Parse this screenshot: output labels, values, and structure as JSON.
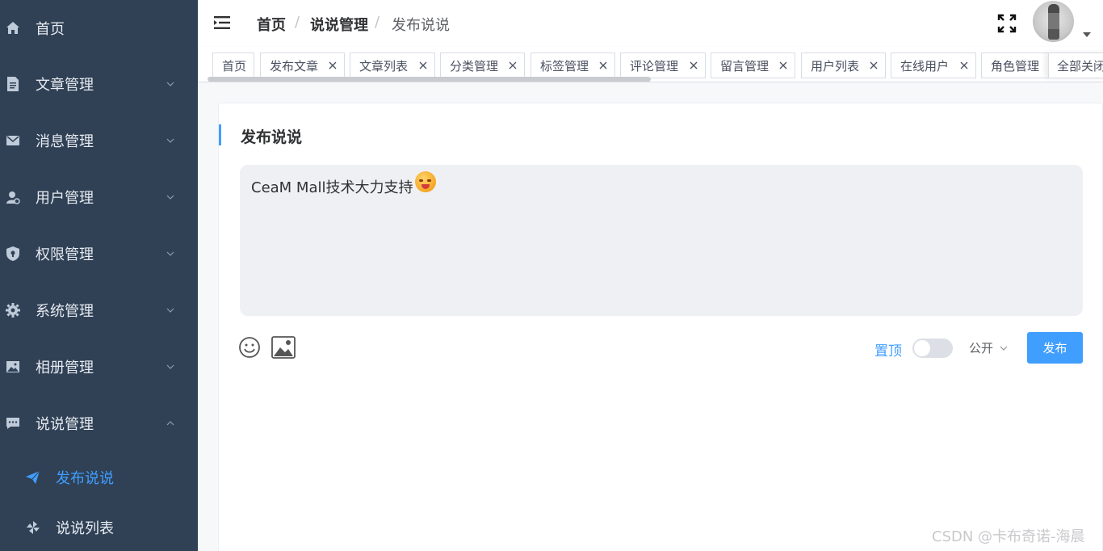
{
  "sidebar": {
    "items": [
      {
        "label": "首页",
        "icon": "home-icon"
      },
      {
        "label": "文章管理",
        "icon": "document-icon"
      },
      {
        "label": "消息管理",
        "icon": "mail-icon"
      },
      {
        "label": "用户管理",
        "icon": "user-icon"
      },
      {
        "label": "权限管理",
        "icon": "shield-icon"
      },
      {
        "label": "系统管理",
        "icon": "gear-icon"
      },
      {
        "label": "相册管理",
        "icon": "photo-icon"
      },
      {
        "label": "说说管理",
        "icon": "chat-icon"
      }
    ],
    "sub_items": [
      {
        "label": "发布说说",
        "icon": "send-icon",
        "active": true
      },
      {
        "label": "说说列表",
        "icon": "pinwheel-icon"
      }
    ],
    "active_color": "#409eff",
    "bg_color": "#304156"
  },
  "header": {
    "breadcrumb": [
      "首页",
      "说说管理",
      "发布说说"
    ],
    "separator": "/"
  },
  "tags": [
    {
      "label": "首页",
      "closable": false
    },
    {
      "label": "发布文章",
      "closable": true
    },
    {
      "label": "文章列表",
      "closable": true
    },
    {
      "label": "分类管理",
      "closable": true
    },
    {
      "label": "标签管理",
      "closable": true
    },
    {
      "label": "评论管理",
      "closable": true
    },
    {
      "label": "留言管理",
      "closable": true
    },
    {
      "label": "用户列表",
      "closable": true
    },
    {
      "label": "在线用户",
      "closable": true
    },
    {
      "label": "角色管理",
      "closable": true
    }
  ],
  "close_all_label": "全部关闭",
  "main": {
    "title": "发布说说",
    "editor_text": "CeaM Mall技术大力支持",
    "pin_label": "置顶",
    "pin_enabled": false,
    "visibility": "公开",
    "publish_label": "发布"
  },
  "watermark": "CSDN @卡布奇诺-海晨",
  "accent_color": "#409eff"
}
